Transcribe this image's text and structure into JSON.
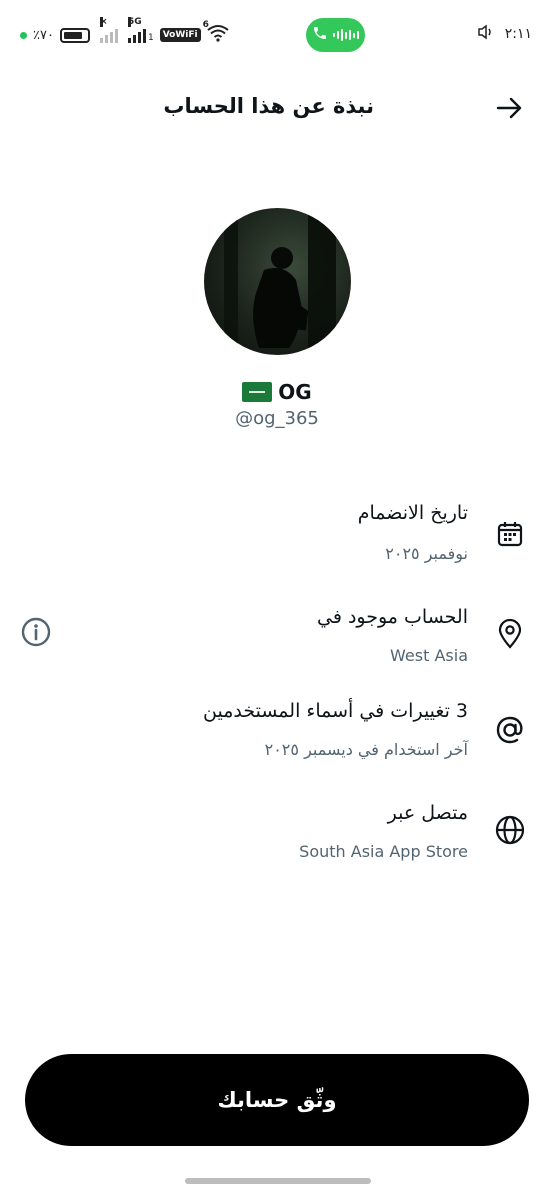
{
  "status_bar": {
    "battery_text": "٪٧٠",
    "network_label": "5G",
    "network_x": "×",
    "network_sub": "1",
    "vowifi_label": "VoWiFi",
    "wifi_sub": "6",
    "time": "٢:١١"
  },
  "header": {
    "title": "نبذة عن هذا الحساب"
  },
  "profile": {
    "display_name": "OG",
    "handle": "@og_365"
  },
  "rows": [
    {
      "title": "تاريخ الانضمام",
      "subtitle": "نوفمبر ٢٠٢٥",
      "icon": "calendar-icon"
    },
    {
      "title": "الحساب موجود في",
      "subtitle": "West Asia",
      "icon": "location-pin-icon"
    },
    {
      "title": "3 تغييرات في أسماء المستخدمين",
      "subtitle": "آخر استخدام في ديسمبر ٢٠٢٥",
      "icon": "at-sign-icon"
    },
    {
      "title": "متصل عبر",
      "subtitle": "South Asia App Store",
      "icon": "globe-icon"
    }
  ],
  "verify_button": {
    "label": "وثّق حسابك"
  },
  "colors": {
    "primary_text": "#0f1419",
    "secondary_text": "#536471",
    "call_pill": "#34c759",
    "button_bg": "#000000"
  }
}
